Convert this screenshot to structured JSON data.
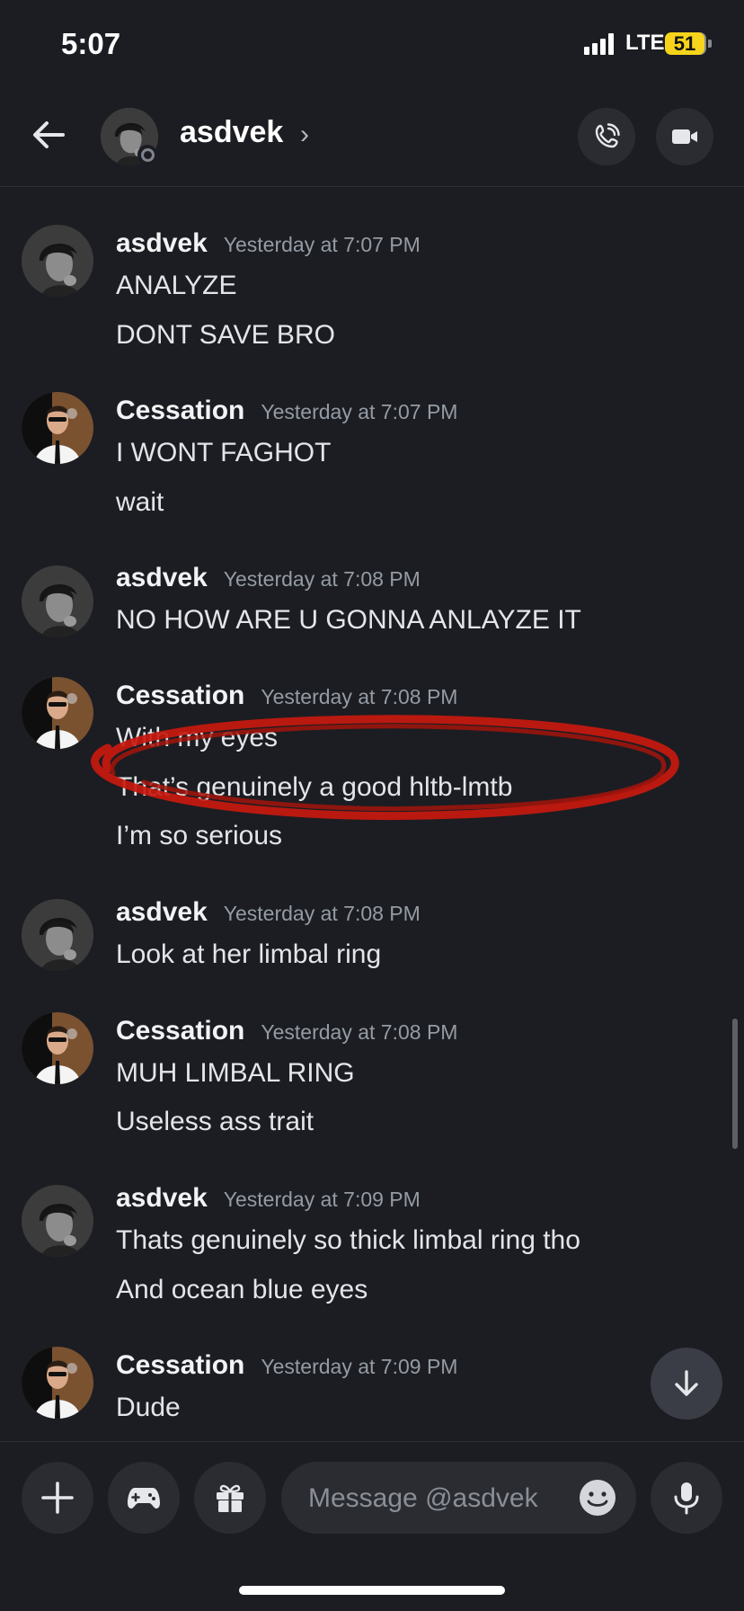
{
  "status": {
    "time": "5:07",
    "network": "LTE",
    "battery": "51"
  },
  "header": {
    "name": "asdvek",
    "chevron": "›"
  },
  "messages": [
    {
      "author": "asdvek",
      "timestamp": "Yesterday at 7:07 PM",
      "lines": [
        "ANALYZE",
        "DONT SAVE BRO"
      ]
    },
    {
      "author": "Cessation",
      "timestamp": "Yesterday at 7:07 PM",
      "lines": [
        "I WONT FAGHOT",
        "wait"
      ]
    },
    {
      "author": "asdvek",
      "timestamp": "Yesterday at 7:08 PM",
      "lines": [
        "NO HOW ARE U GONNA ANLAYZE IT"
      ]
    },
    {
      "author": "Cessation",
      "timestamp": "Yesterday at 7:08 PM",
      "lines": [
        "With my eyes",
        "That’s genuinely a good hltb-lmtb",
        "I’m so serious"
      ]
    },
    {
      "author": "asdvek",
      "timestamp": "Yesterday at 7:08 PM",
      "lines": [
        "Look at her limbal ring"
      ]
    },
    {
      "author": "Cessation",
      "timestamp": "Yesterday at 7:08 PM",
      "lines": [
        "MUH LIMBAL RING",
        "Useless ass trait"
      ]
    },
    {
      "author": "asdvek",
      "timestamp": "Yesterday at 7:09 PM",
      "lines": [
        "Thats genuinely so thick limbal ring tho",
        "And ocean blue eyes"
      ]
    },
    {
      "author": "Cessation",
      "timestamp": "Yesterday at 7:09 PM",
      "lines": [
        "Dude"
      ]
    }
  ],
  "composer": {
    "placeholder": "Message @asdvek"
  },
  "icons": {
    "back": "arrow-left-icon",
    "call": "phone-call-icon",
    "video": "video-camera-icon",
    "add": "plus-icon",
    "games": "gamepad-icon",
    "gift": "gift-icon",
    "emoji": "emoji-smile-icon",
    "mic": "microphone-icon",
    "jump": "arrow-down-icon"
  },
  "colors": {
    "background": "#1c1d22",
    "annotation": "#c8190f",
    "battery": "#f6d41c"
  }
}
